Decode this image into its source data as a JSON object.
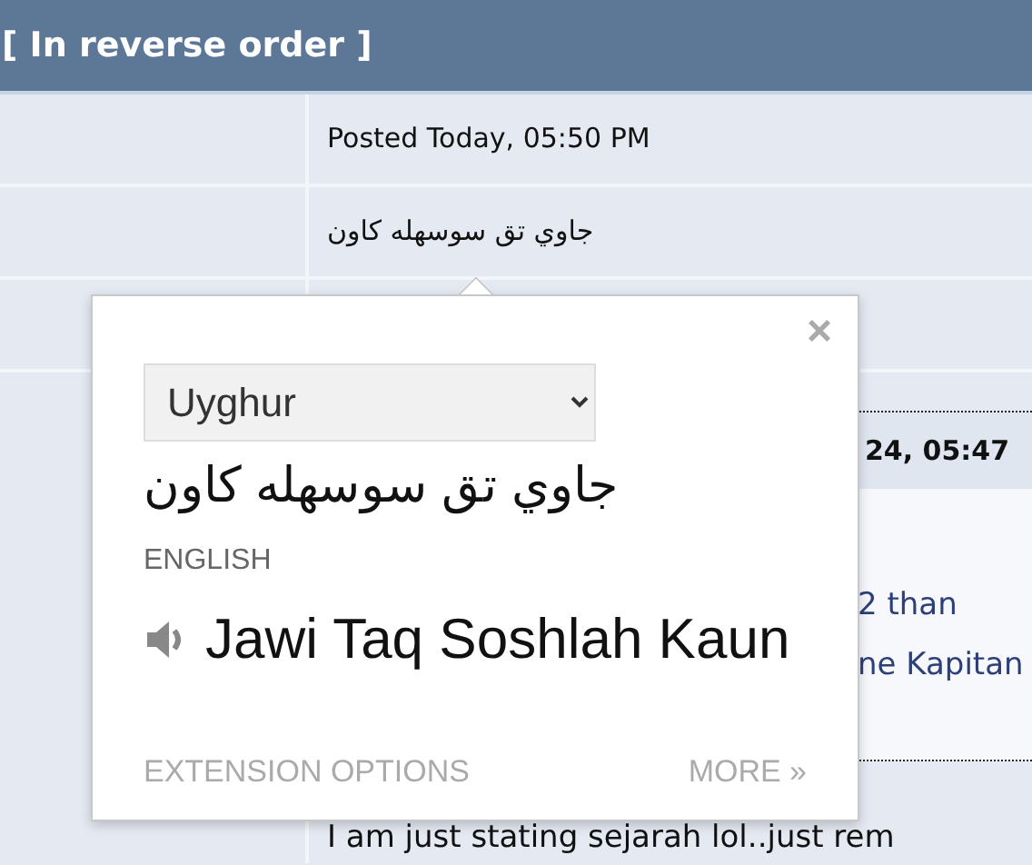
{
  "header": {
    "title": "[ In reverse order ]"
  },
  "post": {
    "posted": "Posted Today, 05:50 PM",
    "text": "جاوي تق سوسهله كاون"
  },
  "next_post": {
    "date": "24, 05:47",
    "quote_lines": [
      "2 than",
      "ne Kapitan"
    ],
    "body": "I am just stating sejarah lol..just rem"
  },
  "popup": {
    "close": "×",
    "source_language": "Uyghur",
    "source_text": "جاوي تق سوسهله كاون",
    "target_language": "ENGLISH",
    "translation": "Jawi Taq Soshlah Kaun",
    "links": [
      "EXTENSION OPTIONS",
      "MORE »"
    ]
  }
}
